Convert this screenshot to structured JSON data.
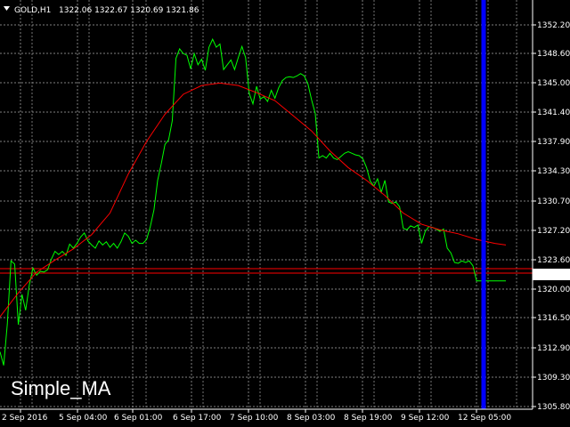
{
  "header": {
    "toggle_icon": "triangle-down-icon",
    "symbol": "GOLD,H1",
    "ohlc": "1322.06 1322.67 1320.69 1321.86"
  },
  "overlay": {
    "indicator_name": "Simple_MA"
  },
  "colors": {
    "background": "#000000",
    "axis": "#ffffff",
    "grid": "#808080",
    "price_series": "#00ff00",
    "moving_average": "#ff0000",
    "current_price_line": "#ff0000",
    "current_price_label_bg": "#ffffff",
    "current_price_label_text": "#000000",
    "vertical_marker": "#0000ff"
  },
  "chart_data": {
    "type": "line",
    "price_axis": {
      "range": [
        1305.8,
        1354.0
      ],
      "ticks": [
        "1352.20",
        "1348.60",
        "1345.00",
        "1341.40",
        "1337.90",
        "1334.30",
        "1330.70",
        "1327.20",
        "1323.60",
        "1320.00",
        "1316.50",
        "1312.90",
        "1309.30",
        "1305.80"
      ],
      "current_price": "1321.86"
    },
    "time_axis": {
      "ticks": [
        "2 Sep 2016",
        "5 Sep 04:00",
        "6 Sep 01:00",
        "6 Sep 17:00",
        "7 Sep 10:00",
        "8 Sep 03:00",
        "8 Sep 19:00",
        "9 Sep 12:00",
        "12 Sep 05:00"
      ]
    },
    "grid": true,
    "series": [
      {
        "name": "GOLD,H1",
        "x": [
          0,
          2,
          4,
          6,
          8,
          10,
          12,
          14,
          16,
          18,
          20,
          22,
          24,
          26,
          28,
          30,
          32,
          34,
          36,
          38,
          40,
          42,
          44,
          46,
          48,
          50,
          52,
          54,
          56,
          58,
          60,
          62,
          64,
          66,
          68,
          70,
          72,
          74,
          76,
          78,
          80,
          82,
          84,
          86,
          88,
          90,
          92,
          94,
          96,
          98,
          100,
          102,
          104,
          106,
          108,
          110,
          112,
          114,
          116,
          118,
          120,
          122,
          124,
          126,
          128,
          130,
          132,
          134,
          136,
          138,
          140,
          142,
          144,
          146,
          148,
          150,
          152,
          154,
          156,
          158,
          160,
          162,
          164,
          166,
          168,
          170,
          172,
          174,
          176,
          178,
          180,
          182,
          184,
          186,
          188,
          190,
          192,
          194,
          196,
          198,
          200,
          202,
          204,
          206,
          208,
          210,
          212,
          214,
          216,
          218,
          220,
          222,
          224,
          226,
          228,
          230,
          232,
          234,
          236,
          238,
          240,
          242,
          244,
          246,
          248,
          250,
          252,
          254,
          256,
          258,
          260,
          262,
          264,
          266,
          268,
          270,
          272,
          274,
          276
        ],
        "values": [
          1313,
          1311.3,
          1316.5,
          1324.4,
          1324.0,
          1316.4,
          1320.2,
          1318.2,
          1321.4,
          1323.5,
          1322.6,
          1323.1,
          1323.0,
          1323.3,
          1324.6,
          1325.6,
          1325.2,
          1325.6,
          1325.1,
          1326.5,
          1326.0,
          1326.6,
          1327.4,
          1327.9,
          1326.9,
          1326.4,
          1326.0,
          1326.9,
          1326.4,
          1326.8,
          1326.1,
          1326.6,
          1326.0,
          1326.8,
          1327.9,
          1327.5,
          1326.6,
          1327.0,
          1326.6,
          1326.6,
          1327.1,
          1328.7,
          1330.8,
          1334.5,
          1336.6,
          1339.0,
          1339.6,
          1342.0,
          1349.8,
          1351.0,
          1350.4,
          1350.2,
          1348.5,
          1350.4,
          1349.0,
          1349.7,
          1348.3,
          1351.2,
          1352.2,
          1351.2,
          1351.6,
          1348.4,
          1349.0,
          1349.6,
          1348.4,
          1349.9,
          1351.3,
          1349.9,
          1345.4,
          1344.1,
          1346.3,
          1344.7,
          1345.0,
          1344.4,
          1345.8,
          1344.8,
          1346.1,
          1347.0,
          1347.4,
          1347.5,
          1347.4,
          1347.6,
          1347.9,
          1347.6,
          1346.6,
          1344.6,
          1342.9,
          1337.3,
          1337.6,
          1337.3,
          1337.9,
          1337.3,
          1337.1,
          1337.5,
          1337.9,
          1338.1,
          1337.9,
          1337.7,
          1337.6,
          1337.2,
          1336.1,
          1334.4,
          1333.8,
          1334.7,
          1333.0,
          1334.5,
          1331.8,
          1331.6,
          1331.8,
          1331.2,
          1328.5,
          1328.3,
          1328.8,
          1328.6,
          1328.9,
          1326.6,
          1328.1,
          1328.7,
          1328.6,
          1328.4,
          1328.1,
          1328.4,
          1326.0,
          1325.4,
          1324.2,
          1324.1,
          1324.4,
          1324.2,
          1324.4,
          1323.8,
          1321.9,
          1321.9,
          1321.9,
          1321.9,
          1321.9,
          1321.9,
          1321.9,
          1321.9,
          1321.9
        ]
      },
      {
        "name": "Simple_MA",
        "x": [
          0,
          10,
          20,
          30,
          40,
          50,
          60,
          70,
          80,
          90,
          100,
          110,
          120,
          130,
          140,
          150,
          160,
          170,
          180,
          190,
          200,
          210,
          220,
          230,
          240,
          250,
          260,
          270,
          276
        ],
        "values": [
          1317.4,
          1320.4,
          1323.0,
          1324.5,
          1325.9,
          1327.7,
          1330.4,
          1335.3,
          1339.4,
          1342.8,
          1345.3,
          1346.4,
          1346.7,
          1346.4,
          1345.5,
          1344.5,
          1342.6,
          1340.7,
          1338.2,
          1336.1,
          1334.5,
          1332.6,
          1330.4,
          1329.0,
          1328.3,
          1327.8,
          1327.1,
          1326.6,
          1326.4
        ]
      }
    ],
    "horizontal_lines": [
      1323.9,
      1321.86
    ],
    "vertical_marker_x": 271
  }
}
